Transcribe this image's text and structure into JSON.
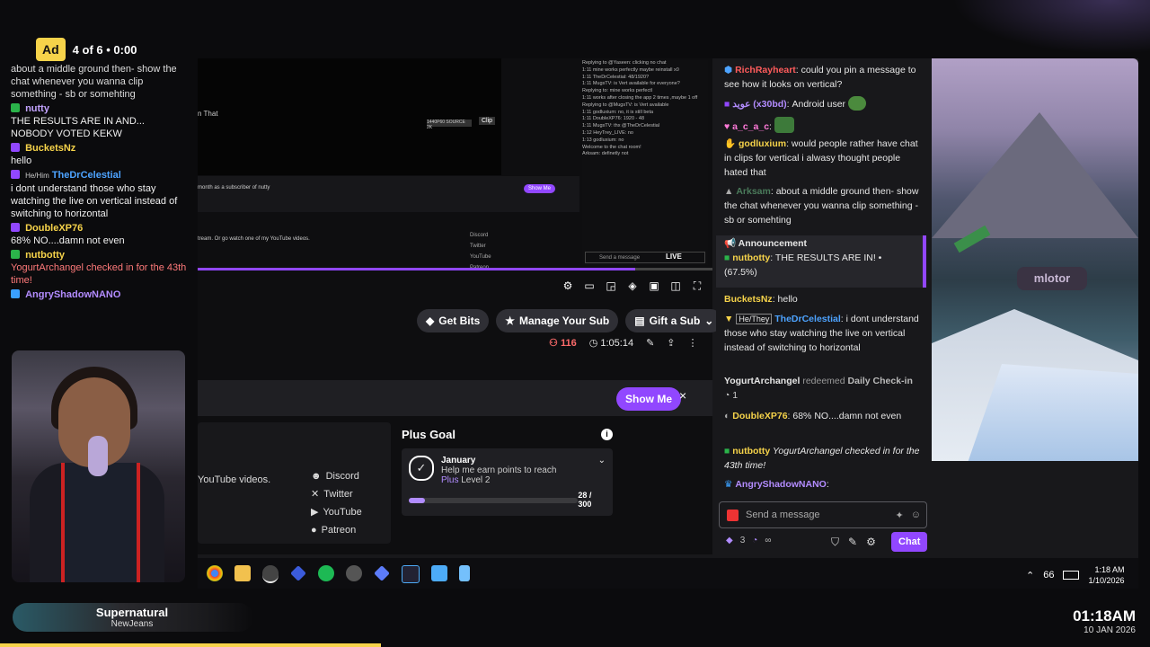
{
  "ad": {
    "badge": "Ad",
    "progress": "4 of 6 • 0:00"
  },
  "overlay_chat": [
    {
      "user": "",
      "text": "about a middle ground then- show the chat whenever you wanna clip something - sb or somehting",
      "user_color": "#aaaaaa"
    },
    {
      "user": "nutty",
      "text": "THE RESULTS ARE IN AND... NOBODY VOTED KEKW",
      "user_color": "#c3a3ff"
    },
    {
      "user": "BucketsNz",
      "text": "hello",
      "user_color": "#f6d34a"
    },
    {
      "user": "TheDrCelestial",
      "prefix": "He/Him",
      "text": "i dont understand those who stay watching the live on vertical instead of switching to horizontal",
      "user_color": "#4da3ff"
    },
    {
      "user": "DoubleXP76",
      "text": "68% NO....damn not even",
      "user_color": "#f6d34a"
    },
    {
      "user": "nutbotty",
      "text": "YogurtArchangel checked in for the 43th time!",
      "user_color": "#f6d34a",
      "text_color": "#ff7a7a"
    },
    {
      "user": "AngryShadowNANO",
      "text": "",
      "user_color": "#b38cff"
    }
  ],
  "video": {
    "mini_sub_text": "month as a subscriber of nutty",
    "mini_show_me": "Show Me",
    "mini_yt_text": "tream. Or go watch one of my YouTube videos.",
    "mini_links": [
      "Discord",
      "Twitter",
      "YouTube",
      "Patreon"
    ],
    "mini_chat": [
      "Replying to @Yaseen: clicking no chat",
      "1:11 mine works perfectly maybe reinstall x0",
      "1:11 TheDrCelestial: 48/1920?",
      "1:11 MugsTV: is Vert available for everyone?",
      "Replying to: mine works perfectl",
      "1:11 works after closing the app 2 times ,maybe 1 off",
      "Replying to @MugsTV: is Vert available",
      "1:11 godluxium: no, it is still beta",
      "1:11 DoubleXP76: 1920 - 48",
      "1:11 MugsTV: thx @TheDrCelestial",
      "1:12 HeyTrey_LIVE: no",
      "1:13 godluxium: no",
      "Welcome to the chat room!",
      "Arksam: definetly not"
    ],
    "mini_live": "LIVE",
    "mini_send": "Send a message",
    "title_fragment": "n That",
    "clip": "Clip",
    "quality": "1440P60 SOURCE 2K",
    "progress_fraction": 0.85
  },
  "actions": {
    "get_bits": "Get Bits",
    "manage_sub": "Manage Your Sub",
    "gift_sub": "Gift a Sub"
  },
  "stats": {
    "viewers": "116",
    "uptime": "1:05:14"
  },
  "banner": {
    "show_me": "Show Me",
    "close": "×"
  },
  "about": {
    "yt_text": "YouTube videos.",
    "links": [
      "Discord",
      "Twitter",
      "YouTube",
      "Patreon"
    ]
  },
  "plus_goal": {
    "title": "Plus Goal",
    "month": "January",
    "desc": "Help me earn points to reach",
    "level_a": "Plus",
    "level_b": "Level 2",
    "progress": "28 / 300",
    "fraction": 0.0933
  },
  "chat": {
    "messages": [
      {
        "user": "RichRayheart",
        "text": ": could you pin a message to see how it looks on vertical?",
        "color": "#ff5c5c"
      },
      {
        "user": "عويد (x30bd)",
        "text": ": Android user",
        "color": "#b38cff"
      },
      {
        "user": "a_c_a_c",
        "text": ":",
        "color": "#ff7ad9"
      },
      {
        "user": "godluxium",
        "text": ": would people rather have chat in clips for vertical i alwasy thought people hated that",
        "color": "#f6d34a"
      },
      {
        "user": "Arksam",
        "text": ": about a middle ground then- show the chat whenever you wanna clip something - sb or somehting",
        "color": "#4a7a5a"
      }
    ],
    "announcement": {
      "title": "Announcement",
      "user": "nutbotty",
      "text": ": THE RESULTS ARE IN! •",
      "percent": "(67.5%)"
    },
    "messages2": [
      {
        "user": "BucketsNz",
        "text": ": hello",
        "color": "#f6d34a"
      },
      {
        "user": "TheDrCelestial",
        "prefix": "He/They",
        "text": ": i dont understand those who stay watching the live on vertical instead of switching to horizontal",
        "color": "#4da3ff"
      }
    ],
    "redeem": {
      "user": "YogurtArchangel",
      "action": "redeemed",
      "reward": "Daily Check-in",
      "count": "1"
    },
    "messages3": [
      {
        "user": "DoubleXP76",
        "text": ": 68% NO....damn not even",
        "color": "#f6d34a"
      },
      {
        "user": "nutbotty",
        "text": " YogurtArchangel checked in for the 43th time!",
        "color": "#f6d34a"
      },
      {
        "user": "AngryShadowNANO",
        "text": ":",
        "color": "#b38cff"
      }
    ],
    "input_placeholder": "Send a message",
    "points": "3",
    "infinity": "∞",
    "chat_button": "Chat"
  },
  "game": {
    "sign": "mlotor"
  },
  "tray": {
    "count": "66",
    "time": "1:18 AM",
    "date": "1/10/2026"
  },
  "now_playing": {
    "title": "Supernatural",
    "artist": "NewJeans"
  },
  "clock": {
    "time": "01:18AM",
    "date": "10 JAN 2026"
  },
  "colors": {
    "accent": "#9147ff",
    "ad_yellow": "#f6d34a",
    "live_red": "#eb0400"
  }
}
